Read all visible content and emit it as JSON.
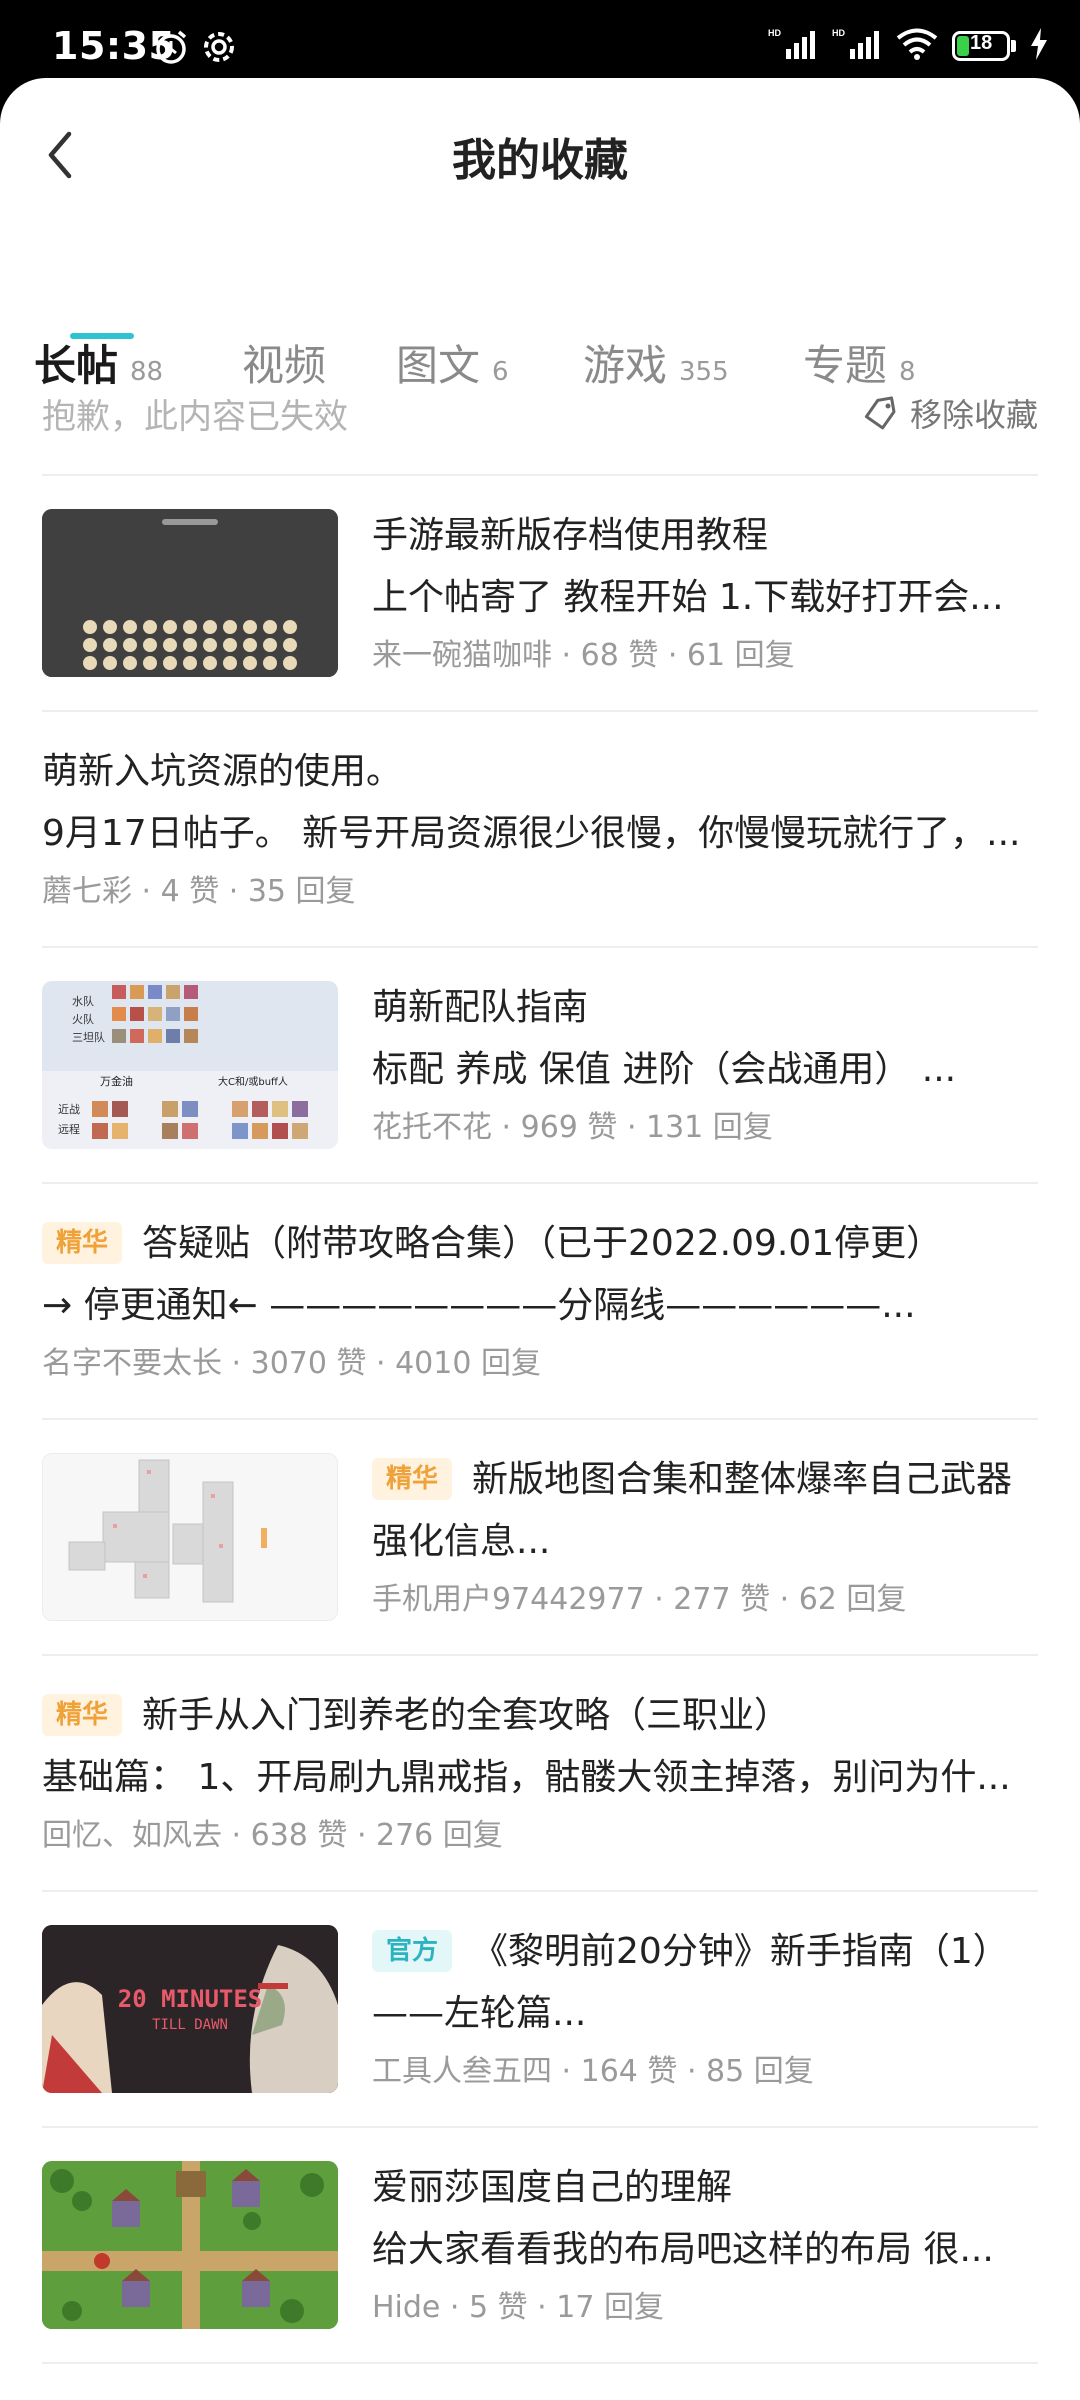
{
  "status_bar": {
    "time": "15:35",
    "battery": "18"
  },
  "header": {
    "title": "我的收藏"
  },
  "tabs": [
    {
      "label": "长帖",
      "count": "88"
    },
    {
      "label": "视频",
      "count": ""
    },
    {
      "label": "图文",
      "count": "6"
    },
    {
      "label": "游戏",
      "count": "355"
    },
    {
      "label": "专题",
      "count": "8"
    }
  ],
  "notice": {
    "text": "抱歉，此内容已失效",
    "remove_label": "移除收藏"
  },
  "items": [
    {
      "title": "手游最新版存档使用教程",
      "excerpt": "上个帖寄了 教程开始 1.下载好打开会...",
      "meta": "来一碗猫咖啡 · 68 赞 · 61 回复"
    },
    {
      "title": "萌新入坑资源的使用。",
      "excerpt": "9月17日帖子。 新号开局资源很少很慢，你慢慢玩就行了，...",
      "meta": "蘑七彩 · 4 赞 · 35 回复"
    },
    {
      "title": "萌新配队指南",
      "excerpt": "标配 养成 保值 进阶（会战通用） ...",
      "meta": "花托不花 · 969 赞 · 131 回复"
    },
    {
      "badge": "精华",
      "title": "答疑贴（附带攻略合集）（已于2022.09.01停更）",
      "excerpt": "→ 停更通知← ————————分隔线——————...",
      "meta": "名字不要太长 · 3070 赞 · 4010 回复"
    },
    {
      "badge": "精华",
      "title": "新版地图合集和整体爆率自己武器",
      "excerpt": "强化信息...",
      "meta": "手机用户97442977 · 277 赞 · 62 回复"
    },
    {
      "badge": "精华",
      "title": "新手从入门到养老的全套攻略（三职业）",
      "excerpt": "基础篇： 1、开局刷九鼎戒指，骷髅大领主掉落，别问为什...",
      "meta": "回忆、如风去 · 638 赞 · 276 回复"
    },
    {
      "badge": "官方",
      "title": "《黎明前20分钟》新手指南（1）",
      "excerpt": "——左轮篇...",
      "meta": "工具人叁五四 · 164 赞 · 85 回复"
    },
    {
      "title": "爱丽莎国度自己的理解",
      "excerpt": "给大家看看我的布局吧这样的布局 很...",
      "meta": "Hide · 5 赞 · 17 回复"
    }
  ],
  "thumbs": {
    "game_art_title": "20 MINUTES",
    "game_art_subtitle": "TILL DAWN",
    "team_rows": [
      "水队",
      "火队",
      "三坦队",
      "近战",
      "远程"
    ],
    "team_labels": [
      "万金油",
      "大C和/或buff人"
    ]
  }
}
